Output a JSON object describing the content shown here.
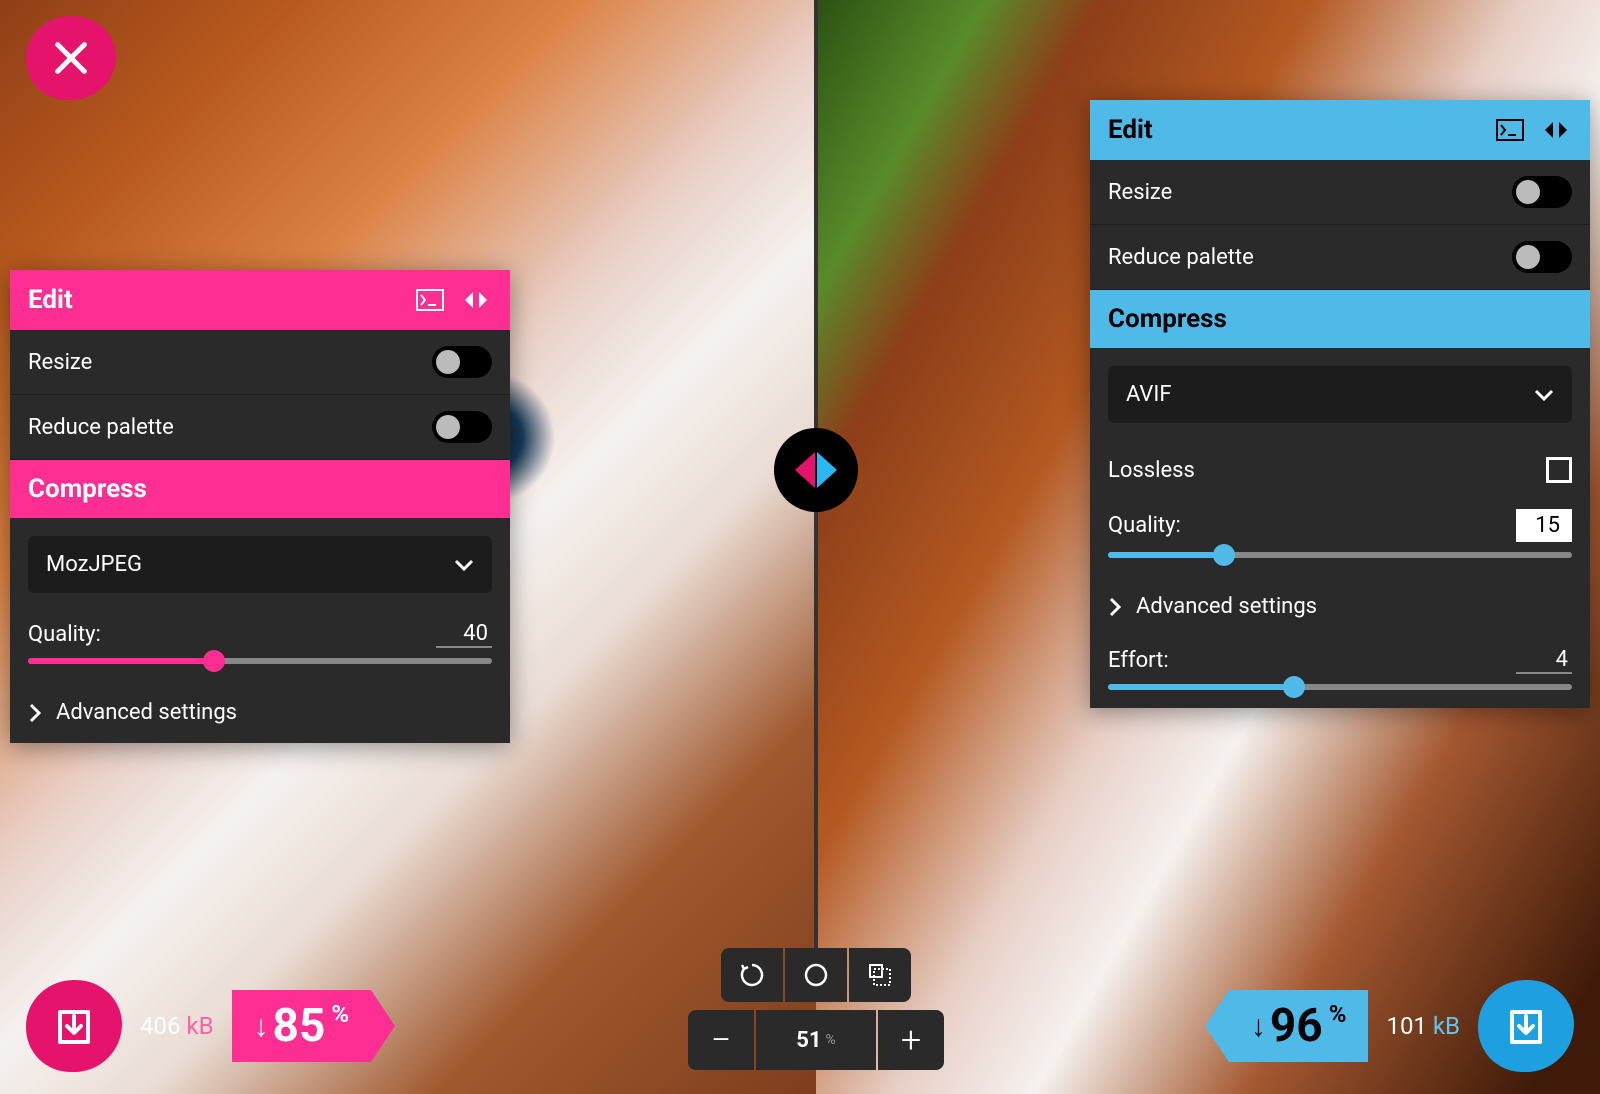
{
  "close_icon": "close",
  "zoom": {
    "value": "51",
    "unit": "%",
    "minus": "−",
    "plus": "+"
  },
  "left": {
    "edit_label": "Edit",
    "resize_label": "Resize",
    "reduce_palette_label": "Reduce palette",
    "compress_label": "Compress",
    "codec": "MozJPEG",
    "quality_label": "Quality:",
    "quality_value": "40",
    "quality_percent": 40,
    "advanced_label": "Advanced settings",
    "file_size": "406",
    "file_unit": "kB",
    "savings": "85",
    "savings_unit": "%"
  },
  "right": {
    "edit_label": "Edit",
    "resize_label": "Resize",
    "reduce_palette_label": "Reduce palette",
    "compress_label": "Compress",
    "codec": "AVIF",
    "lossless_label": "Lossless",
    "quality_label": "Quality:",
    "quality_value": "15",
    "quality_percent": 25,
    "advanced_label": "Advanced settings",
    "effort_label": "Effort:",
    "effort_value": "4",
    "effort_percent": 40,
    "file_size": "101",
    "file_unit": "kB",
    "savings": "96",
    "savings_unit": "%"
  }
}
